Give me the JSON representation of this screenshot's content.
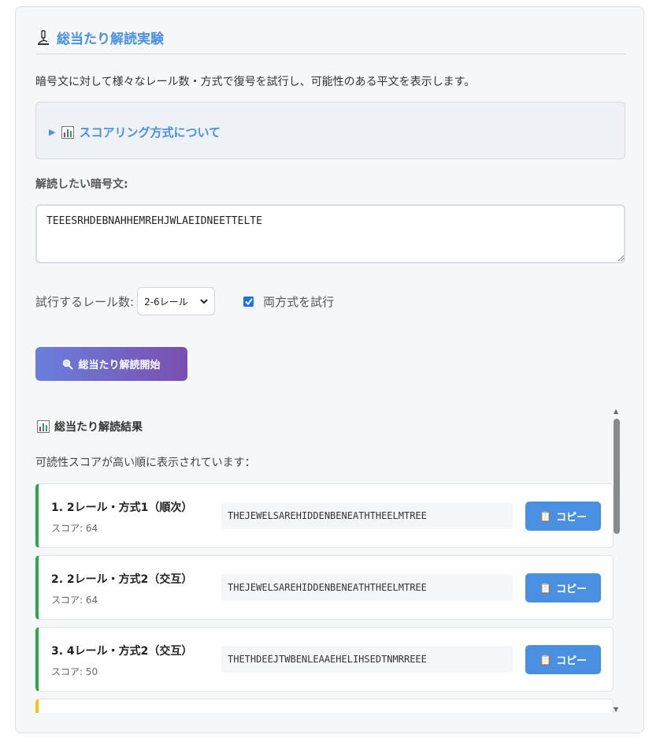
{
  "header": {
    "title": "総当たり解読実験"
  },
  "description": "暗号文に対して様々なレール数・方式で復号を試行し、可能性のある平文を表示します。",
  "details": {
    "summary": "スコアリング方式について"
  },
  "cipher": {
    "label": "解読したい暗号文:",
    "value": "TEEESRHDEBNAHHEMREHJWLAEIDNEETTELTE"
  },
  "options": {
    "rail_label": "試行するレール数:",
    "rail_selected": "2-6レール",
    "both_methods_label": "両方式を試行",
    "both_methods_checked": true
  },
  "start_button": {
    "label": "総当たり解読開始"
  },
  "results": {
    "title": "総当たり解読結果",
    "subtitle": "可読性スコアが高い順に表示されています：",
    "items": [
      {
        "title": "1. 2レール・方式1（順次）",
        "score": "スコア: 64",
        "text": "THEJEWELSAREHIDDENBENEATHTHEELMTREE",
        "copy_label": "コピー"
      },
      {
        "title": "2. 2レール・方式2（交互）",
        "score": "スコア: 64",
        "text": "THEJEWELSAREHIDDENBENEATHTHEELMTREE",
        "copy_label": "コピー"
      },
      {
        "title": "3. 4レール・方式2（交互）",
        "score": "スコア: 50",
        "text": "THETHDEEJTWBENLEAAEHELIHSEDTNMRREEE",
        "copy_label": "コピー"
      }
    ]
  },
  "colors": {
    "accent": "#4a90e2",
    "success_border": "#2ea44f",
    "warning_border": "#f5c518",
    "button_gradient_start": "#6a7fdc",
    "button_gradient_end": "#7a4fb0"
  }
}
